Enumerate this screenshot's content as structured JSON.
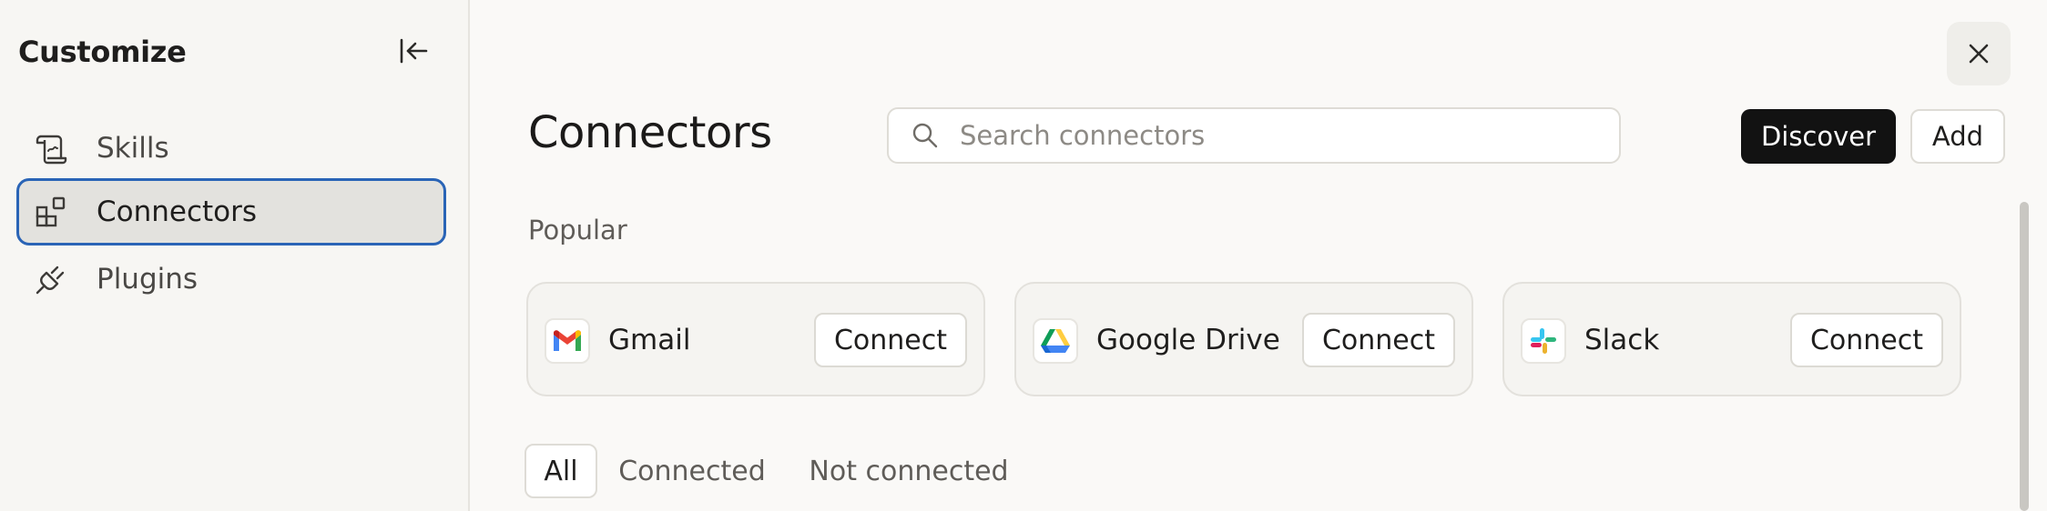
{
  "sidebar": {
    "title": "Customize",
    "collapse_icon": "collapse-left-icon",
    "items": [
      {
        "label": "Skills",
        "icon": "scroll-icon",
        "active": false
      },
      {
        "label": "Connectors",
        "icon": "grid-blocks-icon",
        "active": true
      },
      {
        "label": "Plugins",
        "icon": "plug-icon",
        "active": false
      }
    ]
  },
  "main": {
    "close_icon": "close-icon",
    "title": "Connectors",
    "search": {
      "placeholder": "Search connectors",
      "value": ""
    },
    "discover_label": "Discover",
    "add_label": "Add",
    "popular_label": "Popular",
    "popular": [
      {
        "name": "Gmail",
        "icon": "gmail-icon",
        "action": "Connect"
      },
      {
        "name": "Google Drive",
        "icon": "google-drive-icon",
        "action": "Connect"
      },
      {
        "name": "Slack",
        "icon": "slack-icon",
        "action": "Connect"
      }
    ],
    "filters": [
      {
        "label": "All",
        "active": true
      },
      {
        "label": "Connected",
        "active": false
      },
      {
        "label": "Not connected",
        "active": false
      }
    ]
  },
  "colors": {
    "background": "#faf9f7",
    "sidebar_bg": "#f7f6f3",
    "active_item_bg": "#e3e2de",
    "active_item_border": "#2a64b6",
    "primary_button": "#121212"
  }
}
